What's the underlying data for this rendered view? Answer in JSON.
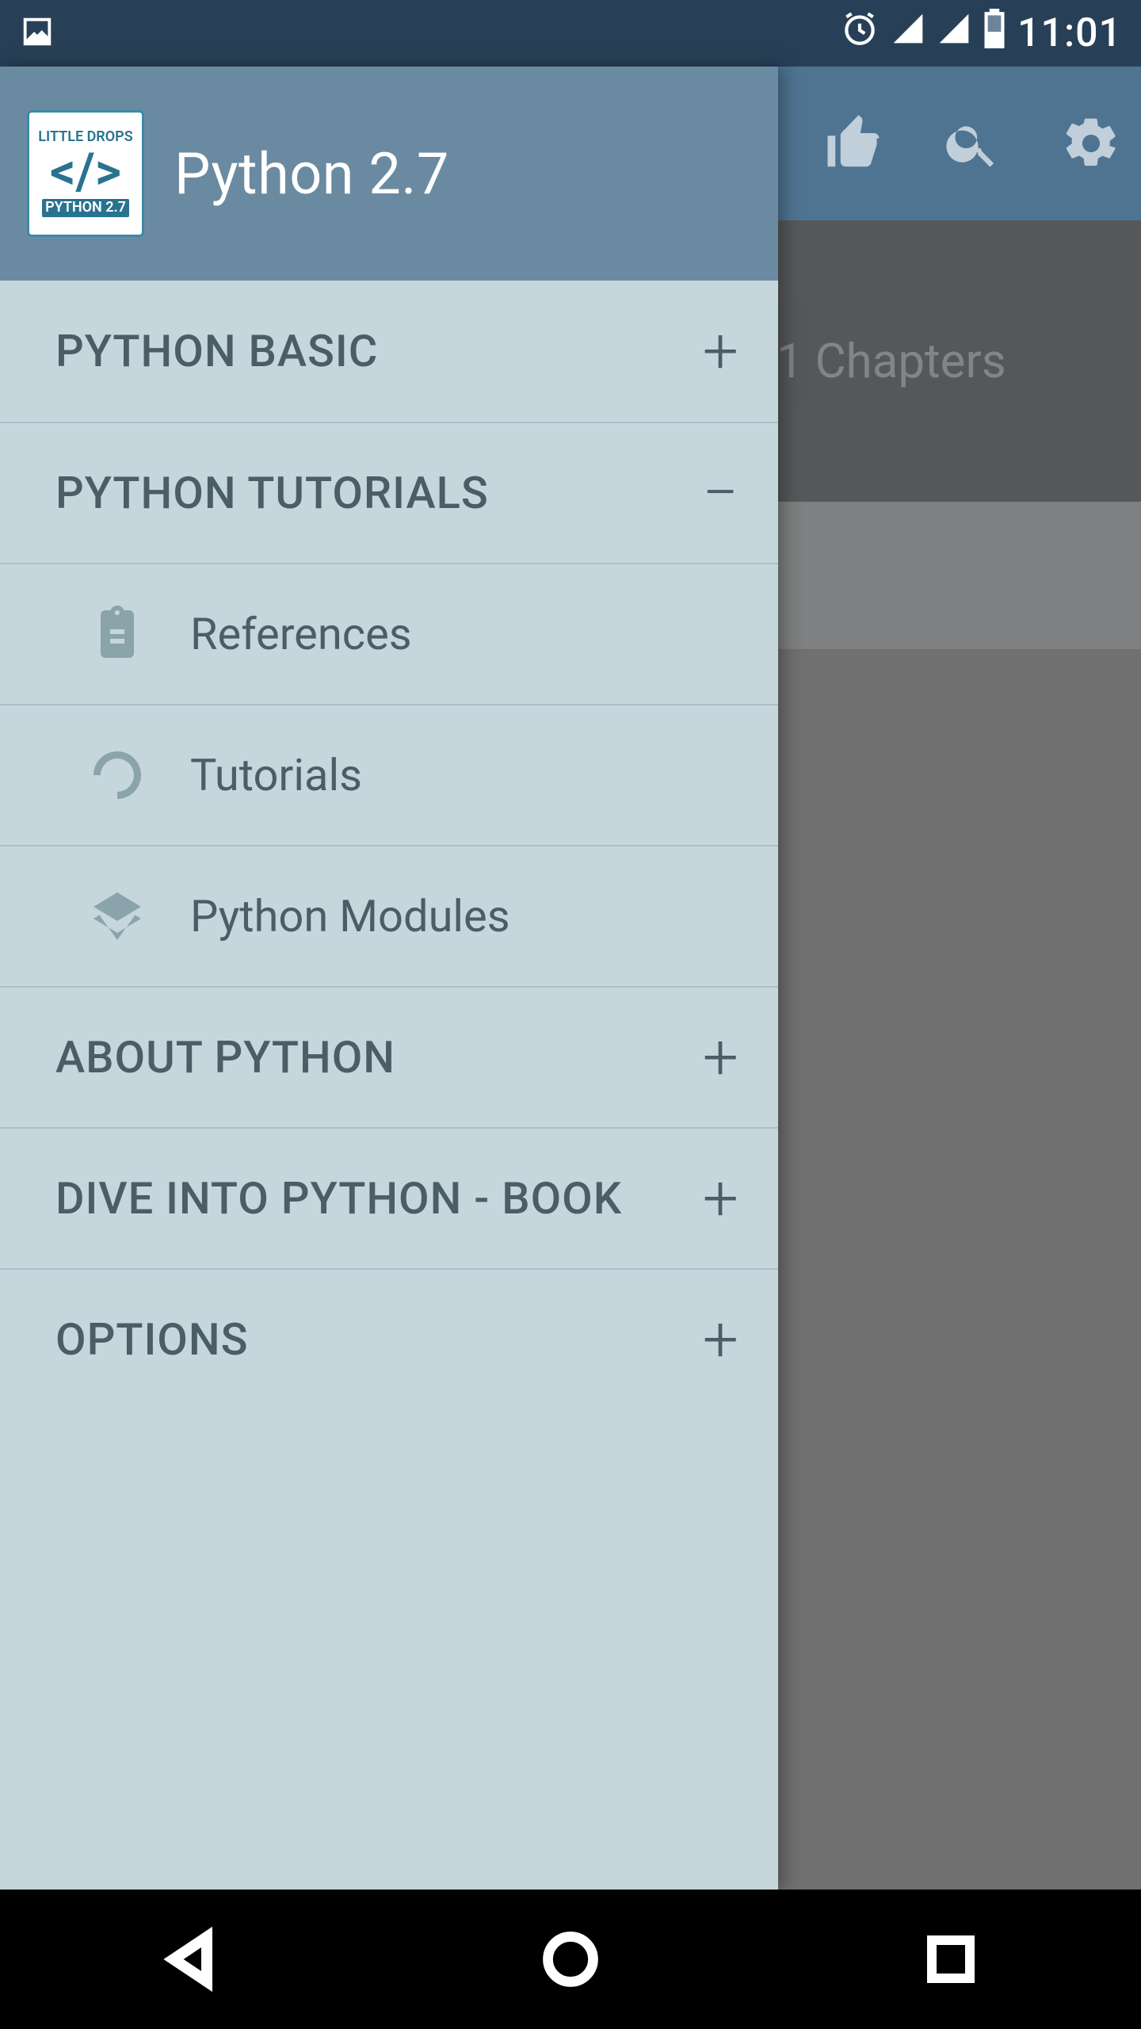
{
  "status_bar": {
    "clock": "11:01"
  },
  "app_bar": {
    "like_icon": "thumbs-up",
    "search_icon": "search",
    "settings_icon": "gear"
  },
  "background": {
    "chapter_text": "1 Chapters"
  },
  "drawer": {
    "logo": {
      "line1": "LITTLE DROPS",
      "line2": "</>",
      "line3": "PYTHON 2.7"
    },
    "title": "Python 2.7",
    "items": [
      {
        "label": "PYTHON BASIC",
        "state": "collapsed",
        "symbol": "+"
      },
      {
        "label": "PYTHON TUTORIALS",
        "state": "expanded",
        "symbol": "−",
        "children": [
          {
            "label": "References",
            "icon": "clipboard"
          },
          {
            "label": "Tutorials",
            "icon": "spinner"
          },
          {
            "label": "Python Modules",
            "icon": "layers"
          }
        ]
      },
      {
        "label": "ABOUT PYTHON",
        "state": "collapsed",
        "symbol": "+"
      },
      {
        "label": "DIVE INTO PYTHON - BOOK",
        "state": "collapsed",
        "symbol": "+"
      },
      {
        "label": "OPTIONS",
        "state": "collapsed",
        "symbol": "+"
      }
    ]
  }
}
